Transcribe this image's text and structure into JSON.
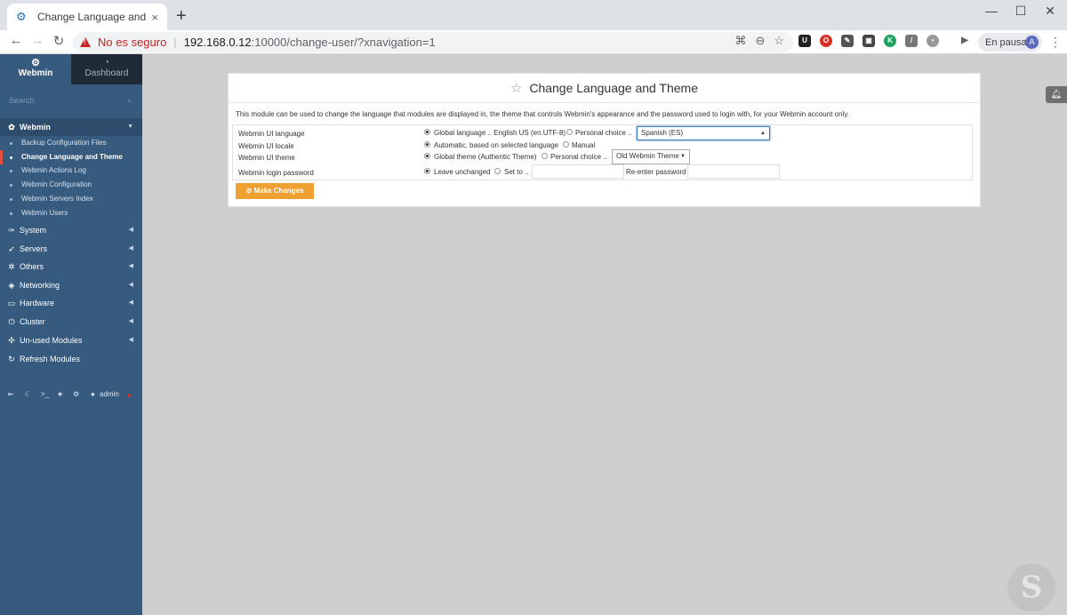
{
  "browser": {
    "tab_title": "Change Language and Theme —",
    "tab_close": "×",
    "new_tab": "+",
    "insecure_label": "No es seguro",
    "separator": "|",
    "url_host": "192.168.0.12",
    "url_path": ":10000/change-user/?xnavigation=1",
    "profile_status": "En pausa",
    "profile_initial": "A",
    "window_controls": {
      "minimize": "—",
      "maximize": "☐",
      "close": "✕"
    }
  },
  "sidebar": {
    "brand": "Webmin",
    "dashboard": "Dashboard",
    "search_placeholder": "Search",
    "categories": [
      {
        "label": "Webmin",
        "icon": "gear-icon",
        "active": true
      },
      {
        "label": "System",
        "icon": "wrench-icon"
      },
      {
        "label": "Servers",
        "icon": "rocket-icon"
      },
      {
        "label": "Others",
        "icon": "cog-icon"
      },
      {
        "label": "Networking",
        "icon": "shield-icon"
      },
      {
        "label": "Hardware",
        "icon": "hdd-icon"
      },
      {
        "label": "Cluster",
        "icon": "power-icon"
      },
      {
        "label": "Un-used Modules",
        "icon": "puzzle-icon"
      },
      {
        "label": "Refresh Modules",
        "icon": "refresh-icon"
      }
    ],
    "webmin_items": [
      "Backup Configuration Files",
      "Change Language and Theme",
      "Webmin Actions Log",
      "Webmin Configuration",
      "Webmin Servers Index",
      "Webmin Users"
    ],
    "footer_user": "admin"
  },
  "page": {
    "title": "Change Language and Theme",
    "intro": "This module can be used to change the language that modules are displayed in, the theme that controls Webmin's appearance and the password used to login with, for your Webmin account only.",
    "rows": {
      "language": {
        "label": "Webmin UI language",
        "opt1": "Global language .. English US (en.UTF-8)",
        "opt2": "Personal choice ..",
        "select_value": "Spanish (ES)"
      },
      "locale": {
        "label": "Webmin UI locale",
        "opt1": "Automatic, based on selected language",
        "opt2": "Manual"
      },
      "theme": {
        "label": "Webmin UI theme",
        "opt1": "Global theme (Authentic Theme)",
        "opt2": "Personal choice ..",
        "select_value": "Old Webmin Theme"
      },
      "password": {
        "label": "Webmin login password",
        "opt1": "Leave unchanged",
        "opt2": "Set to ..",
        "reenter_label": "Re-enter password"
      }
    },
    "submit_label": "Make Changes"
  },
  "colors": {
    "sidebar_bg": "#375a7f",
    "button": "#f0a030",
    "insecure": "#c5221f"
  }
}
